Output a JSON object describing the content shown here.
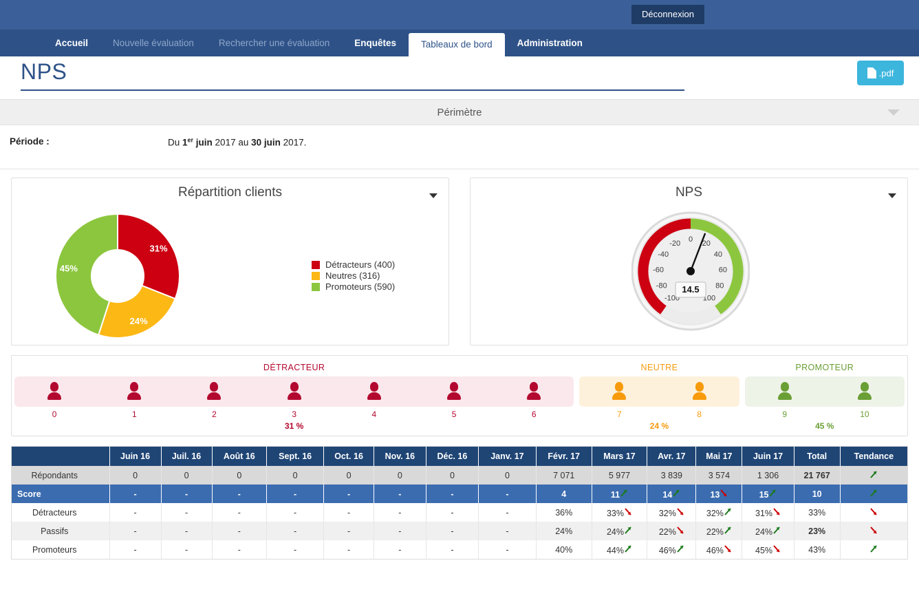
{
  "topbar": {
    "logout_label": "Déconnexion"
  },
  "nav": {
    "items": [
      {
        "label": "Accueil",
        "state": "normal"
      },
      {
        "label": "Nouvelle évaluation",
        "state": "dim"
      },
      {
        "label": "Rechercher une évaluation",
        "state": "dim"
      },
      {
        "label": "Enquêtes",
        "state": "normal"
      },
      {
        "label": "Tableaux de bord",
        "state": "active"
      },
      {
        "label": "Administration",
        "state": "normal"
      }
    ]
  },
  "header": {
    "page_title": "NPS",
    "pdf_label": ".pdf",
    "perimetre_label": "Périmètre"
  },
  "period": {
    "label": "Période :",
    "prefix": "Du ",
    "start_bold": "1",
    "start_sup": "er",
    "start_month": " juin",
    "start_year": " 2017 au ",
    "end_bold": "30 juin",
    "end_year": " 2017."
  },
  "panels": {
    "donut": {
      "title": "Répartition clients",
      "legend": [
        {
          "label": "Détracteurs (400)",
          "color": "#cc0011"
        },
        {
          "label": "Neutres (316)",
          "color": "#fcb814"
        },
        {
          "label": "Promoteurs (590)",
          "color": "#8cc63e"
        }
      ],
      "slice_labels": [
        "31%",
        "24%",
        "45%"
      ]
    },
    "gauge": {
      "title": "NPS",
      "value": "14.5",
      "ticks": [
        "-100",
        "-80",
        "-60",
        "-40",
        "-20",
        "0",
        "20",
        "40",
        "60",
        "80",
        "100"
      ]
    }
  },
  "chart_data": [
    {
      "type": "pie",
      "title": "Répartition clients",
      "categories": [
        "Détracteurs",
        "Neutres",
        "Promoteurs"
      ],
      "values": [
        400,
        316,
        590
      ],
      "percents": [
        31,
        24,
        45
      ],
      "colors": [
        "#cc0011",
        "#fcb814",
        "#8cc63e"
      ],
      "legend": [
        "Détracteurs (400)",
        "Neutres (316)",
        "Promoteurs (590)"
      ],
      "legend_position": "right",
      "donut": true
    },
    {
      "type": "gauge",
      "title": "NPS",
      "value": 14.5,
      "min": -100,
      "max": 100,
      "ticks": [
        -100,
        -80,
        -60,
        -40,
        -20,
        0,
        20,
        40,
        60,
        80,
        100
      ],
      "bands": [
        {
          "from": -100,
          "to": 0,
          "color": "#cc0011"
        },
        {
          "from": 0,
          "to": 100,
          "color": "#8cc63e"
        }
      ]
    },
    {
      "type": "table",
      "title": "NPS mensuel",
      "categories": [
        "Juin 16",
        "Juil. 16",
        "Août 16",
        "Sept. 16",
        "Oct. 16",
        "Nov. 16",
        "Déc. 16",
        "Janv. 17",
        "Févr. 17",
        "Mars 17",
        "Avr. 17",
        "Mai 17",
        "Juin 17"
      ],
      "series": [
        {
          "name": "Répondants",
          "values": [
            0,
            0,
            0,
            0,
            0,
            0,
            0,
            0,
            7071,
            5977,
            3839,
            3574,
            1306
          ],
          "total": 21767
        },
        {
          "name": "Score",
          "values": [
            null,
            null,
            null,
            null,
            null,
            null,
            null,
            null,
            4,
            11,
            14,
            13,
            15
          ],
          "total": 10
        },
        {
          "name": "Détracteurs",
          "values": [
            null,
            null,
            null,
            null,
            null,
            null,
            null,
            null,
            36,
            33,
            32,
            32,
            31
          ],
          "total": 33
        },
        {
          "name": "Passifs",
          "values": [
            null,
            null,
            null,
            null,
            null,
            null,
            null,
            null,
            24,
            24,
            22,
            22,
            24
          ],
          "total": 23
        },
        {
          "name": "Promoteurs",
          "values": [
            null,
            null,
            null,
            null,
            null,
            null,
            null,
            null,
            40,
            44,
            46,
            46,
            45
          ],
          "total": 43
        }
      ]
    }
  ],
  "segments": {
    "groups": [
      {
        "name": "DÉTRACTEUR",
        "color": "#b3082f",
        "bg": "#fae8ec",
        "pct": "31 %",
        "scores": [
          "0",
          "1",
          "2",
          "3",
          "4",
          "5",
          "6"
        ]
      },
      {
        "name": "NEUTRE",
        "color": "#f79a0b",
        "bg": "#fdf1dc",
        "pct": "24 %",
        "scores": [
          "7",
          "8"
        ]
      },
      {
        "name": "PROMOTEUR",
        "color": "#6a9f35",
        "bg": "#eef3e8",
        "pct": "45 %",
        "scores": [
          "9",
          "10"
        ]
      }
    ]
  },
  "table": {
    "columns": [
      "",
      "Juin 16",
      "Juil. 16",
      "Août 16",
      "Sept. 16",
      "Oct. 16",
      "Nov. 16",
      "Déc. 16",
      "Janv. 17",
      "Févr. 17",
      "Mars 17",
      "Avr. 17",
      "Mai 17",
      "Juin 17",
      "Total",
      "Tendance"
    ],
    "rows": [
      {
        "label": "Répondants",
        "style": "respondants",
        "cells": [
          {
            "v": "0"
          },
          {
            "v": "0"
          },
          {
            "v": "0"
          },
          {
            "v": "0"
          },
          {
            "v": "0"
          },
          {
            "v": "0"
          },
          {
            "v": "0"
          },
          {
            "v": "0"
          },
          {
            "v": "7 071"
          },
          {
            "v": "5 977"
          },
          {
            "v": "3 839"
          },
          {
            "v": "3 574"
          },
          {
            "v": "1 306"
          }
        ],
        "total": "21 767",
        "trend": "up"
      },
      {
        "label": "Score",
        "style": "score",
        "cells": [
          {
            "v": "-"
          },
          {
            "v": "-"
          },
          {
            "v": "-"
          },
          {
            "v": "-"
          },
          {
            "v": "-"
          },
          {
            "v": "-"
          },
          {
            "v": "-"
          },
          {
            "v": "-"
          },
          {
            "v": "4"
          },
          {
            "v": "11",
            "trend": "up"
          },
          {
            "v": "14",
            "trend": "up"
          },
          {
            "v": "13",
            "trend": "down"
          },
          {
            "v": "15",
            "trend": "up"
          }
        ],
        "total": "10",
        "trend": "up"
      },
      {
        "label": "Détracteurs",
        "style": "plain",
        "cells": [
          {
            "v": "-"
          },
          {
            "v": "-"
          },
          {
            "v": "-"
          },
          {
            "v": "-"
          },
          {
            "v": "-"
          },
          {
            "v": "-"
          },
          {
            "v": "-"
          },
          {
            "v": "-"
          },
          {
            "v": "36%"
          },
          {
            "v": "33%",
            "trend": "down"
          },
          {
            "v": "32%",
            "trend": "down"
          },
          {
            "v": "32%",
            "trend": "up"
          },
          {
            "v": "31%",
            "trend": "down"
          }
        ],
        "total": "33%",
        "trend": "down"
      },
      {
        "label": "Passifs",
        "style": "alt",
        "cells": [
          {
            "v": "-"
          },
          {
            "v": "-"
          },
          {
            "v": "-"
          },
          {
            "v": "-"
          },
          {
            "v": "-"
          },
          {
            "v": "-"
          },
          {
            "v": "-"
          },
          {
            "v": "-"
          },
          {
            "v": "24%"
          },
          {
            "v": "24%",
            "trend": "up"
          },
          {
            "v": "22%",
            "trend": "down"
          },
          {
            "v": "22%",
            "trend": "up"
          },
          {
            "v": "24%",
            "trend": "up"
          }
        ],
        "total": "23%",
        "trend": "down"
      },
      {
        "label": "Promoteurs",
        "style": "plain",
        "cells": [
          {
            "v": "-"
          },
          {
            "v": "-"
          },
          {
            "v": "-"
          },
          {
            "v": "-"
          },
          {
            "v": "-"
          },
          {
            "v": "-"
          },
          {
            "v": "-"
          },
          {
            "v": "-"
          },
          {
            "v": "40%"
          },
          {
            "v": "44%",
            "trend": "up"
          },
          {
            "v": "46%",
            "trend": "up"
          },
          {
            "v": "46%",
            "trend": "down"
          },
          {
            "v": "45%",
            "trend": "down"
          }
        ],
        "total": "43%",
        "trend": "up"
      }
    ]
  },
  "colors": {
    "nav_bg": "#2e5288",
    "topbar_bg": "#3b6099",
    "accent_blue": "#2e5288",
    "pdf_blue": "#3cb6dd",
    "detractor": "#cc0011",
    "neutral": "#fcb814",
    "promoter": "#8cc63e",
    "trend_up": "#1a7a1a",
    "trend_down": "#cc0000"
  }
}
